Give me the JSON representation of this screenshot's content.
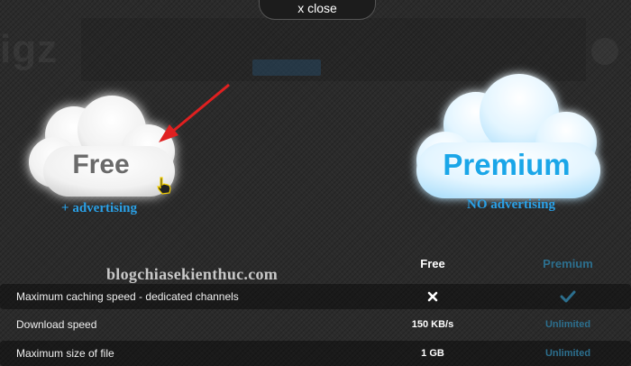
{
  "close_button": {
    "label": "x close"
  },
  "plans": {
    "free": {
      "title": "Free",
      "caption": "+ advertising"
    },
    "premium": {
      "title": "Premium",
      "caption": "NO advertising"
    }
  },
  "watermark": "blogchiasekienthuc.com",
  "comparison": {
    "headers": {
      "free": "Free",
      "premium": "Premium"
    },
    "rows": [
      {
        "label": "Maximum caching speed - dedicated channels",
        "free_icon": "x-icon",
        "premium_icon": "check-icon"
      },
      {
        "label": "Download speed",
        "free": "150 KB/s",
        "premium": "Unlimited"
      },
      {
        "label": "Maximum size of file",
        "free": "1 GB",
        "premium": "Unlimited"
      }
    ]
  },
  "colors": {
    "background": "#2b2b2b",
    "accent_blue": "#1aa6e8",
    "premium_column": "#2c6f8e",
    "annotation_arrow": "#e02020"
  }
}
